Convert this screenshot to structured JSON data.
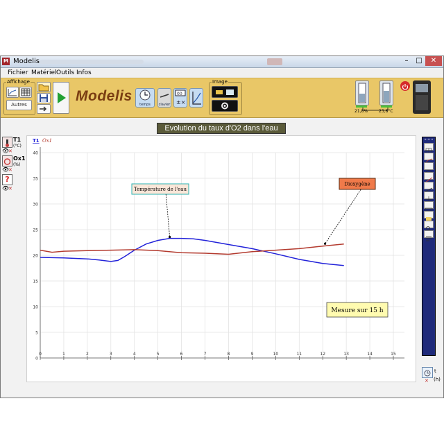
{
  "window": {
    "title": "Modelis",
    "controls": {
      "minimize": "–",
      "maximize": "□",
      "close": "✕"
    },
    "app_icon_letter": "M"
  },
  "menu": [
    "Fichier",
    "Matériel",
    "Outils",
    "Infos"
  ],
  "ribbon": {
    "affichage_label": "Affichage",
    "autres_label": "Autres",
    "brand": "Modelis",
    "temps_label": "temps",
    "clavier_label": "clavier",
    "image_label": "Image",
    "sensor1_value": "21,8%",
    "sensor2_value": "23,8°C"
  },
  "sensors": [
    {
      "name": "T1",
      "unit": "(°C)"
    },
    {
      "name": "Ox1",
      "unit": "(%)"
    },
    {
      "name": "?",
      "unit": ""
    }
  ],
  "colors": {
    "temperature": "#2222d9",
    "oxygen": "#b33a2e",
    "ribbon": "#e9c767",
    "toolbar": "#1f2a7a"
  },
  "chart_data": {
    "type": "line",
    "title": "Evolution du taux d'O2 dans l'eau",
    "xlabel": "",
    "ylabel": "",
    "x_unit": "(h)",
    "xlim": [
      0,
      15
    ],
    "ylim": [
      0,
      40
    ],
    "xticks": [
      0,
      1,
      2,
      3,
      4,
      5,
      6,
      7,
      8,
      9,
      10,
      11,
      12,
      13,
      14,
      15
    ],
    "yticks": [
      0,
      5,
      10,
      15,
      20,
      25,
      30,
      35,
      40
    ],
    "grid": true,
    "legend": [
      "T1",
      "Ox1"
    ],
    "series": [
      {
        "name": "T1",
        "color": "#2222d9",
        "x": [
          0,
          1,
          2,
          2.5,
          3,
          3.3,
          3.6,
          4,
          4.5,
          5,
          5.5,
          6,
          6.5,
          7,
          8,
          9,
          10,
          11,
          12,
          12.9
        ],
        "y": [
          19.6,
          19.5,
          19.3,
          19.1,
          18.8,
          19.0,
          19.8,
          21.0,
          22.2,
          22.9,
          23.3,
          23.3,
          23.2,
          22.9,
          22.1,
          21.3,
          20.3,
          19.2,
          18.4,
          18.0
        ]
      },
      {
        "name": "Ox1",
        "color": "#b33a2e",
        "x": [
          0,
          0.5,
          1,
          2,
          3,
          4,
          5,
          6,
          7,
          8,
          9,
          10,
          11,
          12,
          12.9
        ],
        "y": [
          21.0,
          20.6,
          20.8,
          20.9,
          21.0,
          21.1,
          20.9,
          20.5,
          20.4,
          20.2,
          20.7,
          21.0,
          21.3,
          21.8,
          22.2
        ]
      }
    ],
    "annotations": [
      {
        "text": "Température de l'eau",
        "x": 5.5,
        "y": 23.3
      },
      {
        "text": "Dioxygène",
        "x": 12.1,
        "y": 22.0
      }
    ],
    "note": "Mesure sur 15 h"
  }
}
